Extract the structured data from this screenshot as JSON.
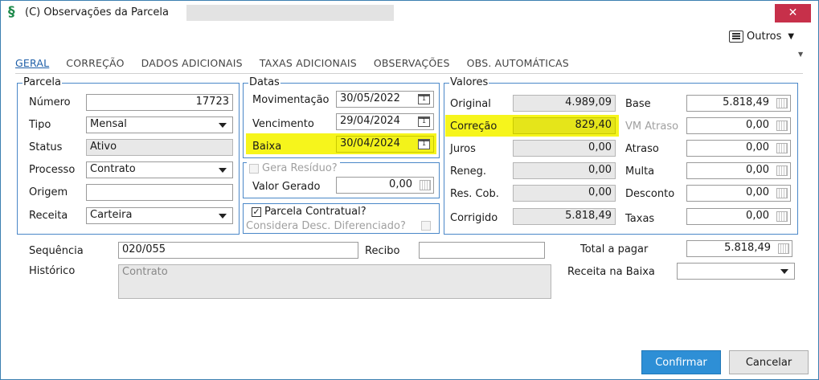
{
  "window": {
    "title": "(C) Observações da Parcela",
    "close_label": "✕"
  },
  "toolbar": {
    "outros_label": "Outros"
  },
  "tabs": [
    {
      "label": "GERAL",
      "active": true
    },
    {
      "label": "CORREÇÃO"
    },
    {
      "label": "DADOS ADICIONAIS"
    },
    {
      "label": "TAXAS ADICIONAIS"
    },
    {
      "label": "OBSERVAÇÕES"
    },
    {
      "label": "OBS. AUTOMÁTICAS"
    }
  ],
  "parcela": {
    "legend": "Parcela",
    "numero_label": "Número",
    "numero_value": "17723",
    "tipo_label": "Tipo",
    "tipo_value": "Mensal",
    "status_label": "Status",
    "status_value": "Ativo",
    "processo_label": "Processo",
    "processo_value": "Contrato",
    "origem_label": "Origem",
    "origem_value": "",
    "receita_label": "Receita",
    "receita_value": "Carteira"
  },
  "datas": {
    "legend": "Datas",
    "movimentacao_label": "Movimentação",
    "movimentacao_value": "30/05/2022",
    "vencimento_label": "Vencimento",
    "vencimento_value": "29/04/2024",
    "baixa_label": "Baixa",
    "baixa_value": "30/04/2024"
  },
  "gera_residuo": {
    "label": "Gera Resíduo?",
    "checked": false,
    "valor_label": "Valor Gerado",
    "valor_value": "0,00"
  },
  "contratual": {
    "label": "Parcela Contratual?",
    "checked": true,
    "desc_label": "Considera Desc. Diferenciado?",
    "desc_checked": false
  },
  "valores": {
    "legend": "Valores",
    "original_label": "Original",
    "original_value": "4.989,09",
    "correcao_label": "Correção",
    "correcao_value": "829,40",
    "juros_label": "Juros",
    "juros_value": "0,00",
    "reneg_label": "Reneg.",
    "reneg_value": "0,00",
    "rescob_label": "Res. Cob.",
    "rescob_value": "0,00",
    "corrigido_label": "Corrigido",
    "corrigido_value": "5.818,49",
    "base_label": "Base",
    "base_value": "5.818,49",
    "vmatraso_label": "VM Atraso",
    "vmatraso_value": "0,00",
    "atraso_label": "Atraso",
    "atraso_value": "0,00",
    "multa_label": "Multa",
    "multa_value": "0,00",
    "desconto_label": "Desconto",
    "desconto_value": "0,00",
    "taxas_label": "Taxas",
    "taxas_value": "0,00"
  },
  "footer": {
    "sequencia_label": "Sequência",
    "sequencia_value": "020/055",
    "recibo_label": "Recibo",
    "recibo_value": "",
    "total_label": "Total a pagar",
    "total_value": "5.818,49",
    "historico_label": "Histórico",
    "historico_value": "Contrato",
    "receita_baixa_label": "Receita na Baixa",
    "receita_baixa_value": ""
  },
  "buttons": {
    "confirmar": "Confirmar",
    "cancelar": "Cancelar"
  },
  "colors": {
    "highlight": "#f3f31a",
    "accent": "#2e8fd6",
    "group_border": "#4a87c8",
    "close": "#c7304a"
  }
}
